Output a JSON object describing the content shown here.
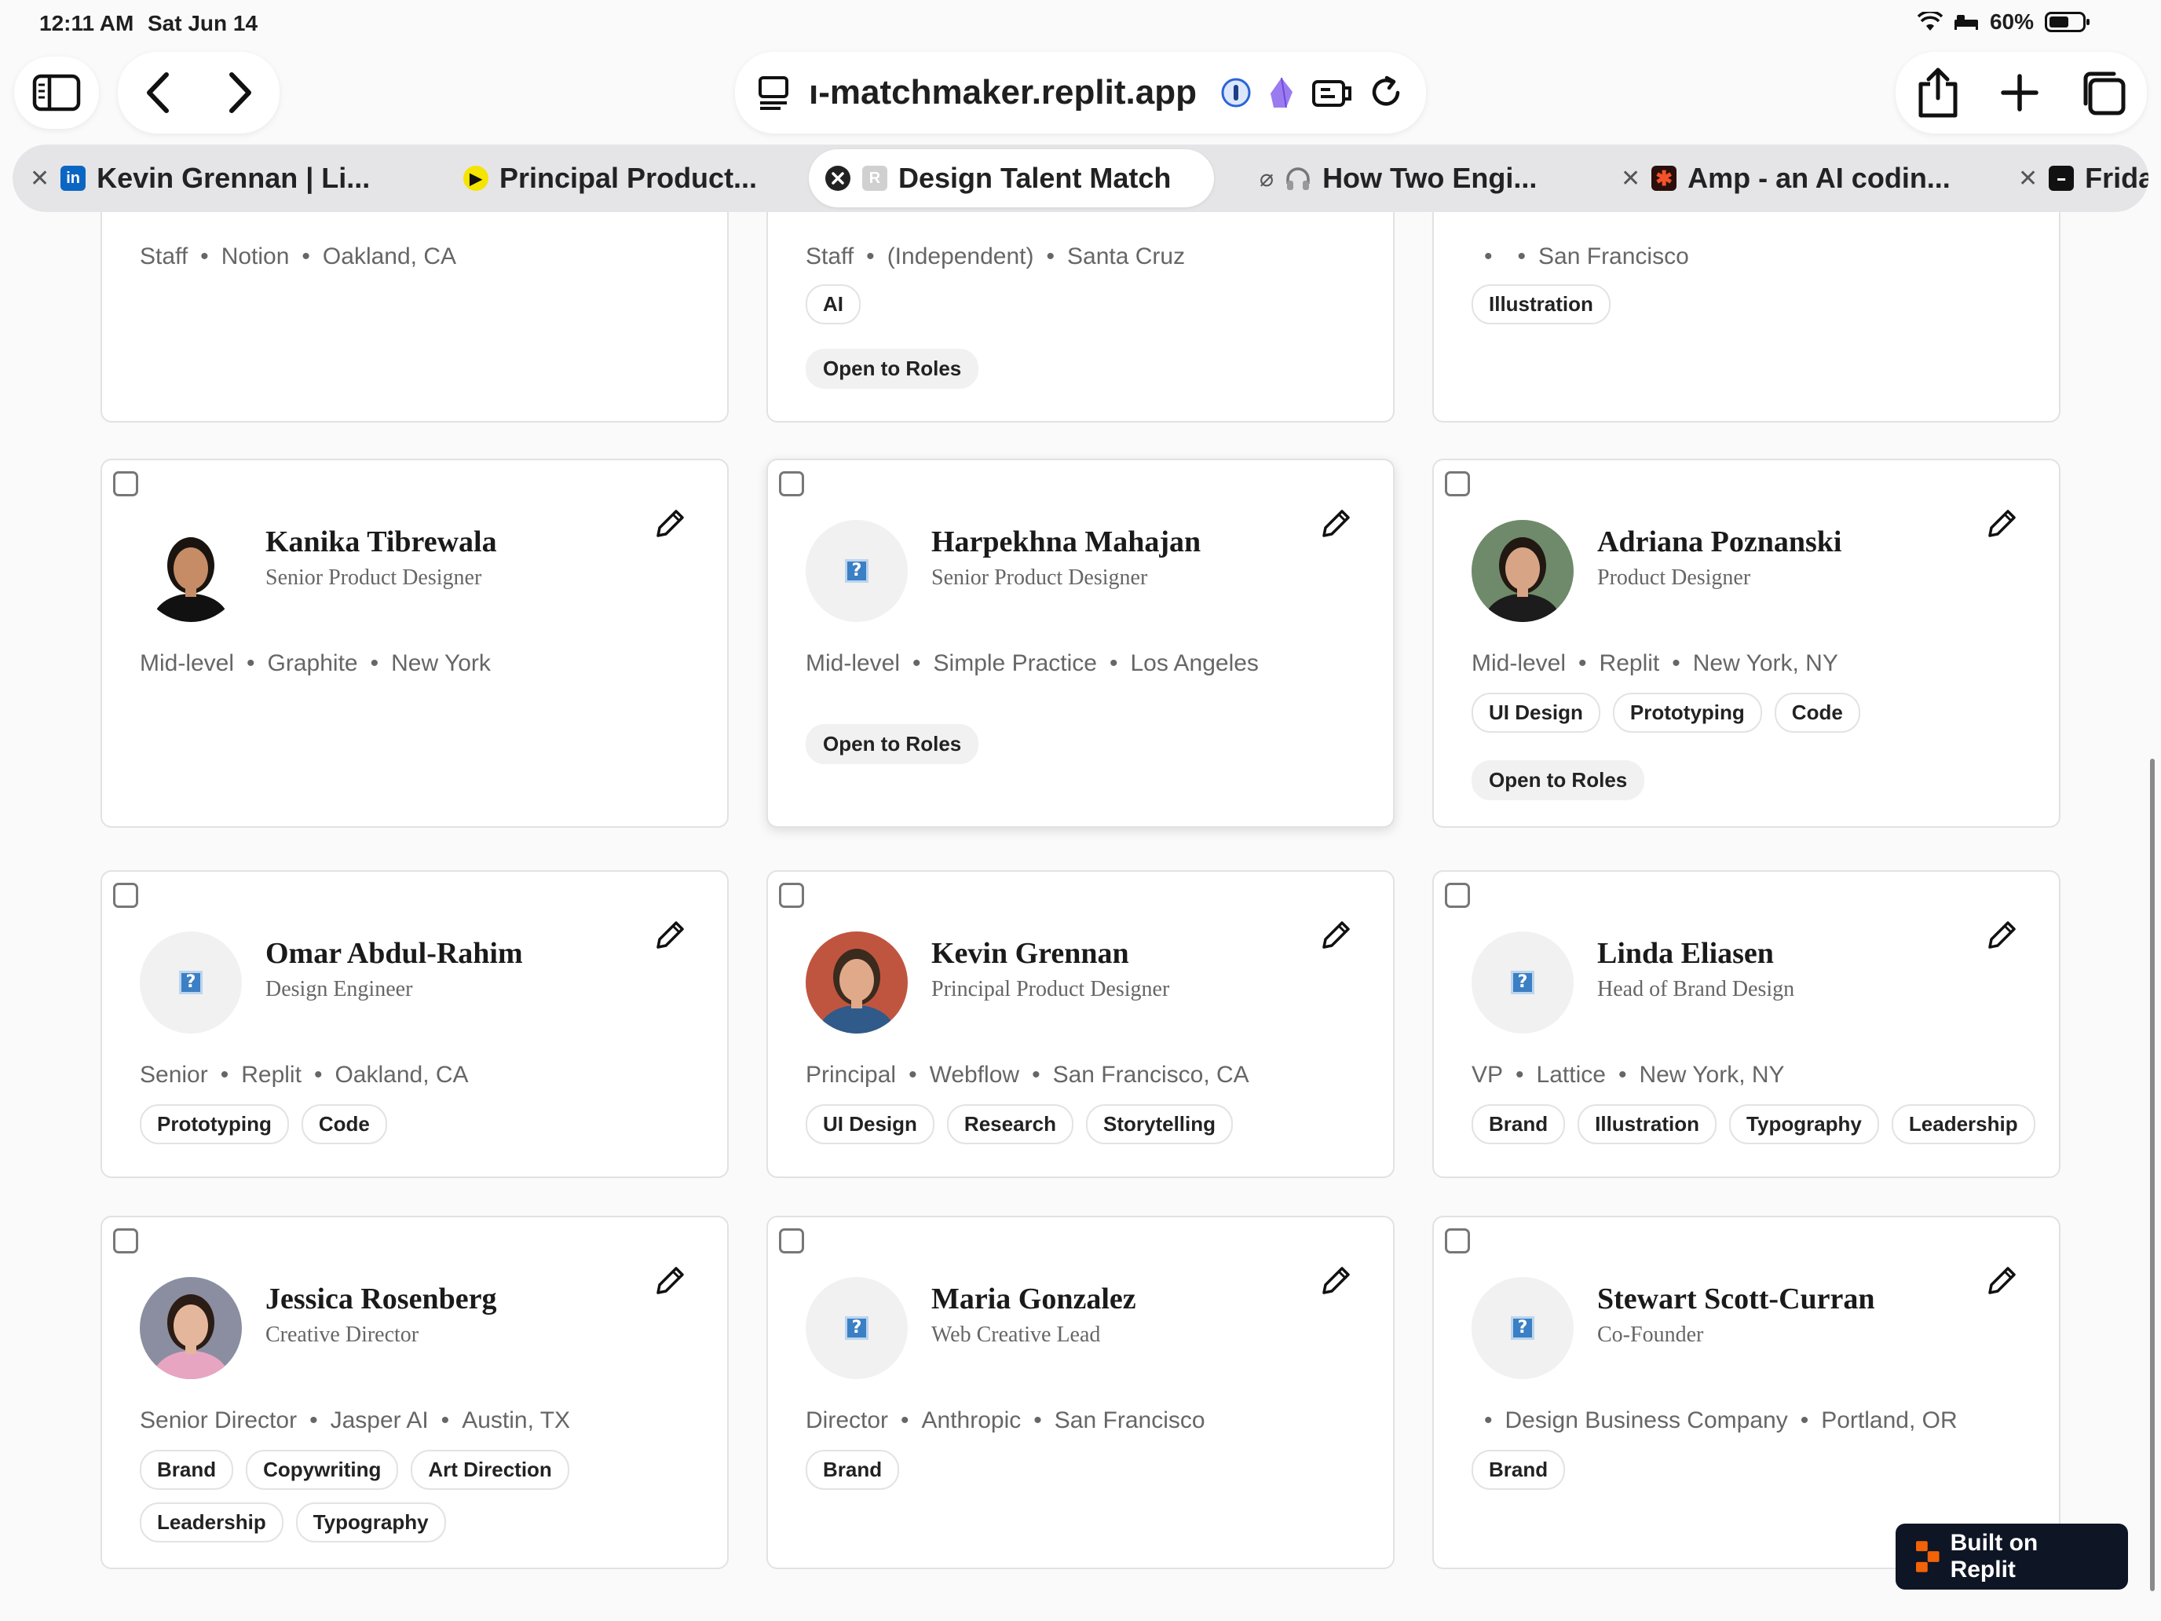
{
  "status_bar": {
    "time": "12:11 AM",
    "date": "Sat Jun 14",
    "battery": "60%",
    "battery_level": 0.6
  },
  "browser": {
    "url": "ı-matchmaker.replit.app",
    "tabs": [
      {
        "title": "Kevin Grennan | Li...",
        "favicon": "linkedin-icon",
        "active": false
      },
      {
        "title": "Principal Product...",
        "favicon": "play-icon",
        "active": false
      },
      {
        "title": "Design Talent Match",
        "favicon": "replit-icon",
        "active": true
      },
      {
        "title": "How Two Engi...",
        "favicon": "headphones-icon",
        "active": false
      },
      {
        "title": "Amp - an AI codin...",
        "favicon": "amp-icon",
        "active": false
      },
      {
        "title": "Frida",
        "favicon": "frida-icon",
        "active": false
      }
    ]
  },
  "top_row": [
    {
      "meta": [
        "Staff",
        "Notion",
        "Oakland, CA"
      ],
      "tags": [],
      "status": ""
    },
    {
      "meta": [
        "Staff",
        "(Independent)",
        "Santa Cruz"
      ],
      "tags": [
        "AI"
      ],
      "status": "Open to Roles"
    },
    {
      "meta": [
        "",
        "",
        "San Francisco"
      ],
      "tags": [
        "Illustration"
      ],
      "status": ""
    }
  ],
  "designers": [
    {
      "name": "Kanika Tibrewala",
      "role": "Senior Product Designer",
      "meta": [
        "Mid-level",
        "Graphite",
        "New York"
      ],
      "tags": [],
      "status": "",
      "avatar": "photo"
    },
    {
      "name": "Harpekhna Mahajan",
      "role": "Senior Product Designer",
      "meta": [
        "Mid-level",
        "Simple Practice",
        "Los Angeles"
      ],
      "tags": [],
      "status": "Open to Roles",
      "avatar": "placeholder"
    },
    {
      "name": "Adriana Poznanski",
      "role": "Product Designer",
      "meta": [
        "Mid-level",
        "Replit",
        "New York, NY"
      ],
      "tags": [
        "UI Design",
        "Prototyping",
        "Code"
      ],
      "status": "Open to Roles",
      "avatar": "photo"
    },
    {
      "name": "Omar Abdul-Rahim",
      "role": "Design Engineer",
      "meta": [
        "Senior",
        "Replit",
        "Oakland, CA"
      ],
      "tags": [
        "Prototyping",
        "Code"
      ],
      "status": "",
      "avatar": "placeholder"
    },
    {
      "name": "Kevin Grennan",
      "role": "Principal Product Designer",
      "meta": [
        "Principal",
        "Webflow",
        "San Francisco, CA"
      ],
      "tags": [
        "UI Design",
        "Research",
        "Storytelling"
      ],
      "status": "",
      "avatar": "photo"
    },
    {
      "name": "Linda Eliasen",
      "role": "Head of Brand Design",
      "meta": [
        "VP",
        "Lattice",
        "New York, NY"
      ],
      "tags": [
        "Brand",
        "Illustration",
        "Typography",
        "Leadership"
      ],
      "status": "",
      "avatar": "placeholder"
    },
    {
      "name": "Jessica Rosenberg",
      "role": "Creative Director",
      "meta": [
        "Senior Director",
        "Jasper AI",
        "Austin, TX"
      ],
      "tags": [
        "Brand",
        "Copywriting",
        "Art Direction",
        "Leadership",
        "Typography"
      ],
      "status": "",
      "avatar": "photo"
    },
    {
      "name": "Maria Gonzalez",
      "role": "Web Creative Lead",
      "meta": [
        "Director",
        "Anthropic",
        "San Francisco"
      ],
      "tags": [
        "Brand"
      ],
      "status": "",
      "avatar": "placeholder"
    },
    {
      "name": "Stewart Scott-Curran",
      "role": "Co-Founder",
      "meta": [
        "",
        "Design Business Company",
        "Portland, OR"
      ],
      "tags": [
        "Brand"
      ],
      "status": "",
      "avatar": "placeholder"
    }
  ],
  "badge": {
    "label": "Built on Replit"
  },
  "colors": {
    "tag_border": "#e3e3e3",
    "status_fill": "#f1f1f1",
    "placeholder_blue": "#3b7fc4",
    "badge_bg": "#0e1525",
    "replit_orange": "#f26207"
  }
}
